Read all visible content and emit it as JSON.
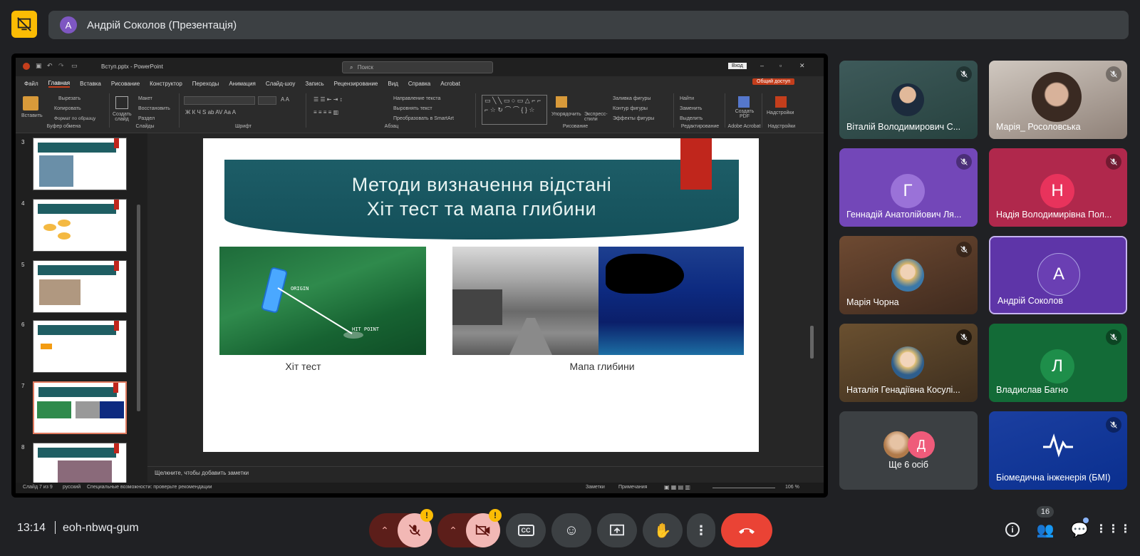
{
  "top": {
    "presenter_initial": "А",
    "presenter_label": "Андрій Соколов (Презентація)"
  },
  "ppt": {
    "filename": "Вступ.pptx - PowerPoint",
    "search_placeholder": "Поиск",
    "signin": "Вход",
    "share": "Общий доступ",
    "menu": [
      "Файл",
      "Главная",
      "Вставка",
      "Рисование",
      "Конструктор",
      "Переходы",
      "Анимация",
      "Слайд-шоу",
      "Запись",
      "Рецензирование",
      "Вид",
      "Справка",
      "Acrobat"
    ],
    "ribbon": {
      "paste": "Вставить",
      "cut": "Вырезать",
      "copy": "Копировать",
      "format_painter": "Формат по образцу",
      "clipboard": "Буфер обмена",
      "new_slide": "Создать слайд",
      "layout": "Макет",
      "reset": "Восстановить",
      "section": "Раздел",
      "slides": "Слайды",
      "font": "Шрифт",
      "text_direction": "Направление текста",
      "align_text": "Выровнять текст",
      "smartart": "Преобразовать в SmartArt",
      "paragraph": "Абзац",
      "arrange": "Упорядочить",
      "quick_styles": "Экспресс-стили",
      "shape_fill": "Заливка фигуры",
      "shape_outline": "Контур фигуры",
      "shape_effects": "Эффекты фигуры",
      "drawing": "Рисование",
      "find": "Найти",
      "replace": "Заменить",
      "select": "Выделить",
      "editing": "Редактирование",
      "create_pdf": "Создать PDF",
      "acrobat": "Adobe Acrobat",
      "addins": "Надстройки",
      "addins_grp": "Надстройки"
    },
    "slide_numbers": [
      "3",
      "4",
      "5",
      "6",
      "7",
      "8"
    ],
    "slide": {
      "title_line1": "Методи визначення відстані",
      "title_line2": "Хіт тест та мапа глибини",
      "origin": "ORIGIN",
      "hit_point": "HIT POINT",
      "caption1": "Хіт тест",
      "caption2": "Мапа глибини"
    },
    "notes_placeholder": "Щелкните, чтобы добавить заметки",
    "status": {
      "slide_of": "Слайд 7 из 9",
      "language": "русский",
      "accessibility": "Специальные возможности: проверьте рекомендации",
      "notes": "Заметки",
      "comments": "Примечания",
      "zoom": "106 %"
    }
  },
  "participants": [
    {
      "name": "Віталій Володимирович С...",
      "muted": true,
      "kind": "photo"
    },
    {
      "name": "Марія_ Росоловська",
      "muted": true,
      "kind": "photo"
    },
    {
      "name": "Геннадій Анатолійович Ля...",
      "muted": true,
      "kind": "letter",
      "letter": "Г",
      "color": "#7b4fc4"
    },
    {
      "name": "Надія Володимирівна Пол...",
      "muted": true,
      "kind": "letter",
      "letter": "Н",
      "color": "#e8335c"
    },
    {
      "name": "Марія Чорна",
      "muted": true,
      "kind": "photo"
    },
    {
      "name": "Андрій Соколов",
      "muted": false,
      "kind": "letter",
      "letter": "А",
      "color": "#6a3fb3"
    },
    {
      "name": "Наталія Генадіївна Косулі...",
      "muted": true,
      "kind": "photo"
    },
    {
      "name": "Владислав Багно",
      "muted": true,
      "kind": "letter",
      "letter": "Л",
      "color": "#188038"
    },
    {
      "name": "Ще 6 осіб",
      "muted": false,
      "kind": "more",
      "letter": "Д"
    },
    {
      "name": "Біомедична інженерія (БМІ)",
      "muted": true,
      "kind": "logo"
    }
  ],
  "bottom": {
    "time": "13:14",
    "meeting_code": "eoh-nbwq-gum",
    "people_count": "16",
    "warn": "!"
  },
  "colors": {
    "bg": "#202124",
    "tile": "#3c4043",
    "danger": "#ea4335",
    "warn": "#fbbc04"
  }
}
